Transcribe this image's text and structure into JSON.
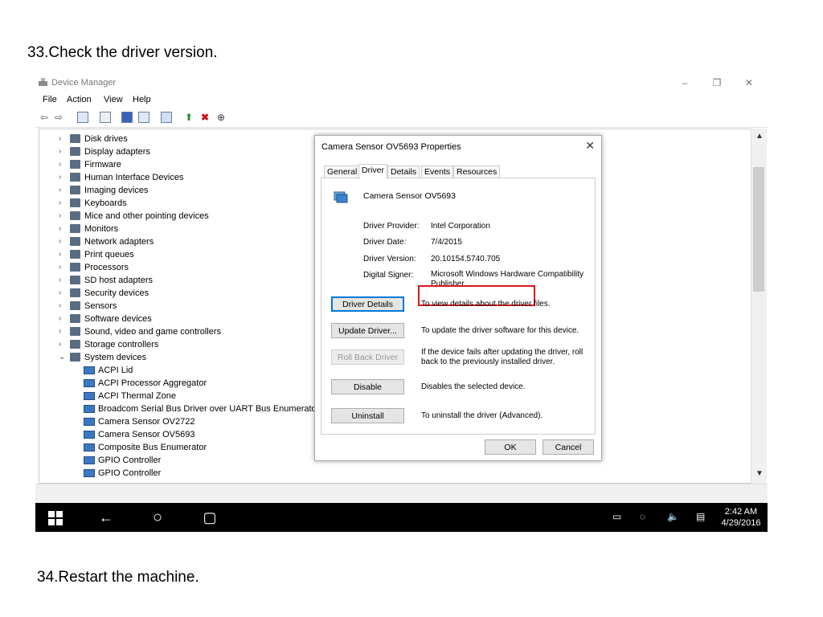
{
  "slide": {
    "step_top": "33.Check the driver version.",
    "step_bottom": "34.Restart the machine."
  },
  "window": {
    "title": "Device Manager",
    "menu": [
      "File",
      "Action",
      "View",
      "Help"
    ],
    "controls": {
      "minimize": "–",
      "maximize": "❐",
      "close": "✕"
    }
  },
  "tree": {
    "categories": [
      {
        "label": "Disk drives",
        "expander": "›"
      },
      {
        "label": "Display adapters",
        "expander": "›"
      },
      {
        "label": "Firmware",
        "expander": "›"
      },
      {
        "label": "Human Interface Devices",
        "expander": "›"
      },
      {
        "label": "Imaging devices",
        "expander": "›"
      },
      {
        "label": "Keyboards",
        "expander": "›"
      },
      {
        "label": "Mice and other pointing devices",
        "expander": "›"
      },
      {
        "label": "Monitors",
        "expander": "›"
      },
      {
        "label": "Network adapters",
        "expander": "›"
      },
      {
        "label": "Print queues",
        "expander": "›"
      },
      {
        "label": "Processors",
        "expander": "›"
      },
      {
        "label": "SD host adapters",
        "expander": "›"
      },
      {
        "label": "Security devices",
        "expander": "›"
      },
      {
        "label": "Sensors",
        "expander": "›"
      },
      {
        "label": "Software devices",
        "expander": "›"
      },
      {
        "label": "Sound, video and game controllers",
        "expander": "›"
      },
      {
        "label": "Storage controllers",
        "expander": "›"
      },
      {
        "label": "System devices",
        "expander": "⌄"
      }
    ],
    "system_devices": [
      "ACPI Lid",
      "ACPI Processor Aggregator",
      "ACPI Thermal Zone",
      "Broadcom Serial Bus Driver over UART Bus Enumerator",
      "Camera Sensor OV2722",
      "Camera Sensor OV5693",
      "Composite Bus Enumerator",
      "GPIO Controller",
      "GPIO Controller"
    ]
  },
  "dialog": {
    "title": "Camera Sensor OV5693 Properties",
    "close": "✕",
    "tabs": [
      "General",
      "Driver",
      "Details",
      "Events",
      "Resources"
    ],
    "active_tab": "Driver",
    "device_name": "Camera Sensor OV5693",
    "properties": [
      {
        "label": "Driver Provider:",
        "value": "Intel Corporation"
      },
      {
        "label": "Driver Date:",
        "value": "7/4/2015"
      },
      {
        "label": "Driver Version:",
        "value": "20.10154.5740.705"
      },
      {
        "label": "Digital Signer:",
        "value": "Microsoft Windows Hardware Compatibility Publisher"
      }
    ],
    "actions": [
      {
        "button": "Driver Details",
        "desc": "To view details about the driver files."
      },
      {
        "button": "Update Driver...",
        "desc": "To update the driver software for this device."
      },
      {
        "button": "Roll Back Driver",
        "desc": "If the device fails after updating the driver, roll back to the previously installed driver."
      },
      {
        "button": "Disable",
        "desc": "Disables the selected device."
      },
      {
        "button": "Uninstall",
        "desc": "To uninstall the driver (Advanced)."
      }
    ],
    "ok": "OK",
    "cancel": "Cancel",
    "highlight_color": "#e0141e"
  },
  "taskbar": {
    "time": "2:42 AM",
    "date": "4/29/2016",
    "back_glyph": "←",
    "cortana_glyph": "○",
    "taskview_glyph": "▢",
    "battery_glyph": "▭",
    "wifi_glyph": "◌",
    "volume_glyph": "🔈",
    "notification_glyph": "▤"
  }
}
